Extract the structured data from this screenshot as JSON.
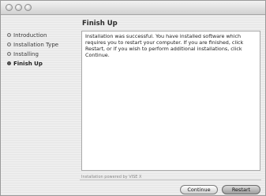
{
  "window": {
    "title": ""
  },
  "sidebar": {
    "steps": [
      {
        "label": "Introduction",
        "active": false
      },
      {
        "label": "Installation Type",
        "active": false
      },
      {
        "label": "Installing",
        "active": false
      },
      {
        "label": "Finish Up",
        "active": true
      }
    ]
  },
  "main": {
    "heading": "Finish Up",
    "message": "Installation was successful. You have installed software which requires you to restart your computer. If you are finished, click Restart, or if you wish to perform additional installations, click Continue.",
    "powered_by": "Installation powered by VISE X"
  },
  "buttons": {
    "continue_label": "Continue",
    "restart_label": "Restart"
  }
}
